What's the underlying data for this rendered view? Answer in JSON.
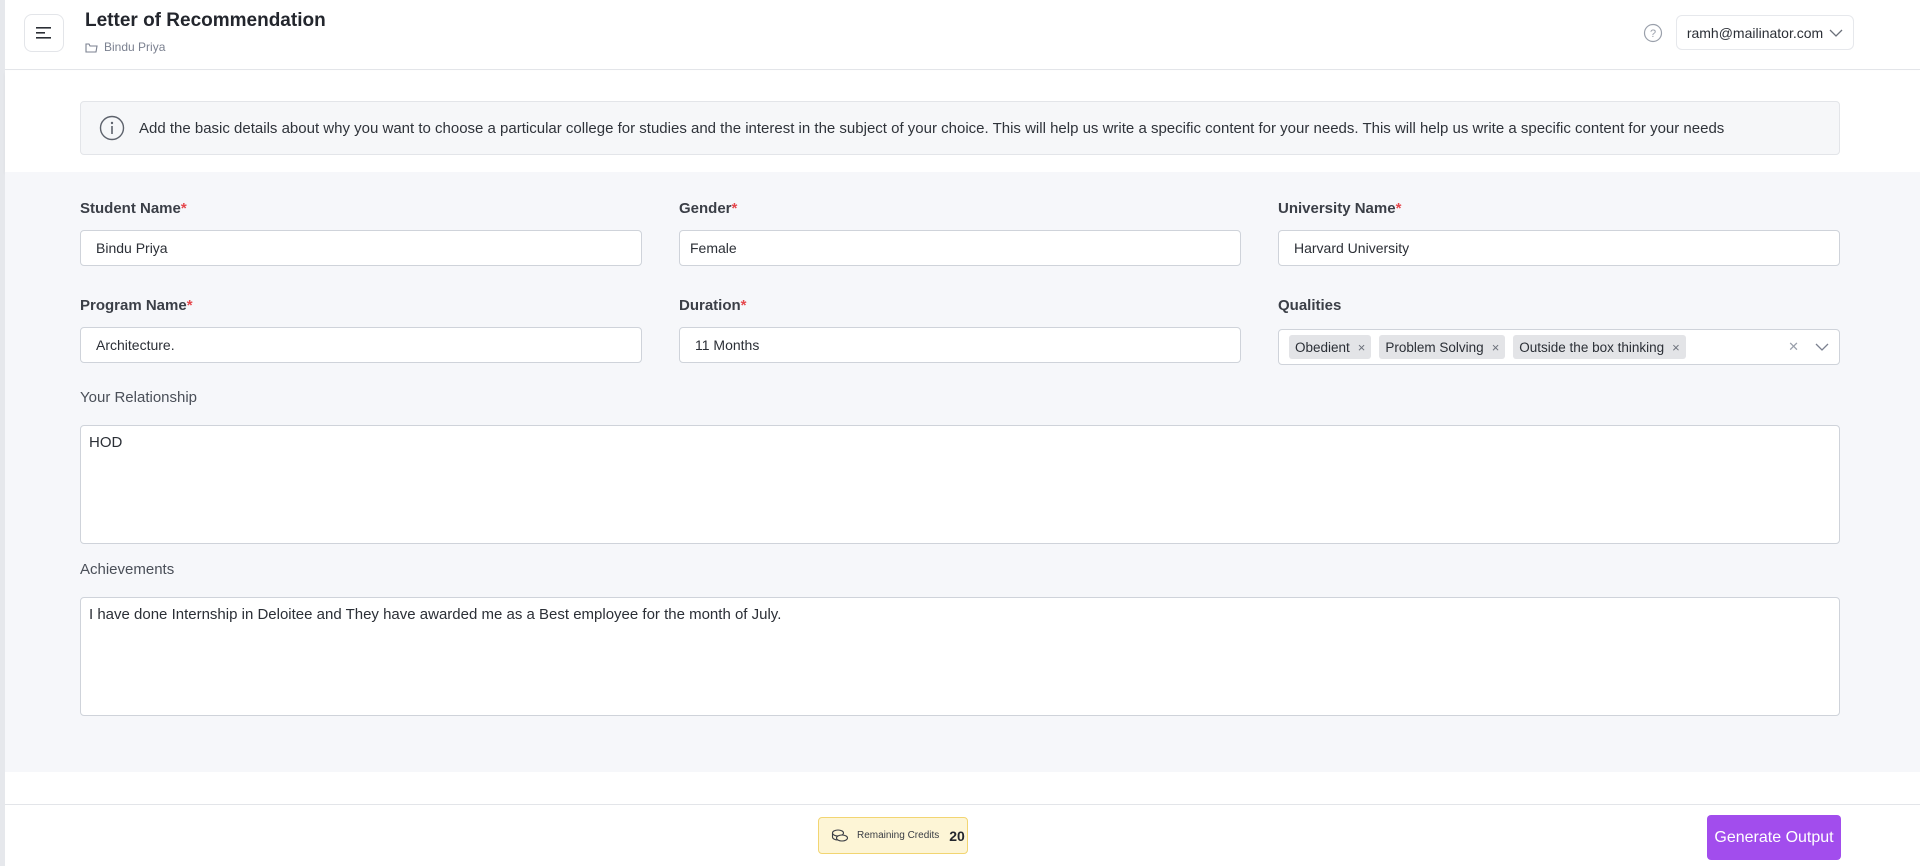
{
  "header": {
    "title": "Letter of Recommendation",
    "breadcrumb": "Bindu Priya",
    "user_email": "ramh@mailinator.com"
  },
  "info": {
    "text": "Add the basic details about why you want to choose a particular college for studies and the interest in the subject of your choice. This will help us write a specific content for your needs. This will help us write a specific content for your needs"
  },
  "form": {
    "student_name": {
      "label": "Student Name",
      "required": "*",
      "value": "Bindu Priya"
    },
    "gender": {
      "label": "Gender",
      "required": "*",
      "value": "Female"
    },
    "university_name": {
      "label": "University Name",
      "required": "*",
      "value": "Harvard University"
    },
    "program_name": {
      "label": "Program Name",
      "required": "*",
      "value": "Architecture."
    },
    "duration": {
      "label": "Duration",
      "required": "*",
      "value": "11 Months"
    },
    "qualities": {
      "label": "Qualities",
      "chips": [
        "Obedient",
        "Problem Solving",
        "Outside the box thinking"
      ],
      "remove_glyph": "×",
      "clear_glyph": "✕"
    },
    "relationship": {
      "label": "Your Relationship",
      "value": "HOD"
    },
    "achievements": {
      "label": "Achievements",
      "value": "I have done Internship in Deloitee and They have awarded me as a Best employee for the month of July."
    }
  },
  "footer": {
    "credits_label": "Remaining Credits",
    "credits_value": "20",
    "generate_label": "Generate Output"
  },
  "colors": {
    "accent": "#a24ded",
    "required": "#e5484d",
    "credits_bg": "#fdf5d6"
  }
}
